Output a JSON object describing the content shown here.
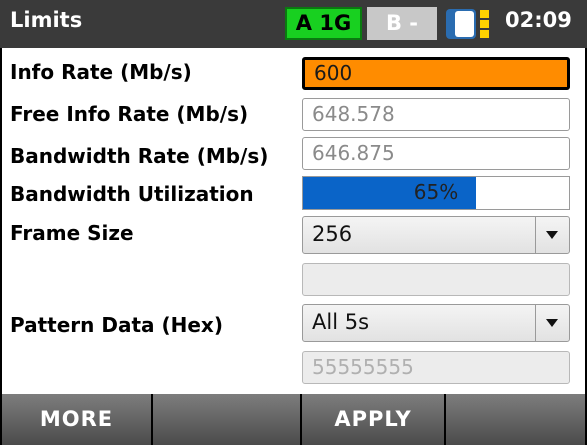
{
  "header": {
    "title": "Limits",
    "port_a": "A 1G",
    "port_b": "B -",
    "time": "02:09",
    "battery_icon": "battery-icon"
  },
  "fields": {
    "info_rate": {
      "label": "Info Rate (Mb/s)",
      "value": "600"
    },
    "free_info_rate": {
      "label": "Free Info Rate (Mb/s)",
      "value": "648.578"
    },
    "bandwidth_rate": {
      "label": "Bandwidth Rate (Mb/s)",
      "value": "646.875"
    },
    "bandwidth_utilization": {
      "label": "Bandwidth Utilization",
      "value": "65%",
      "fraction": 0.65
    },
    "frame_size": {
      "label": "Frame Size",
      "value": "256"
    },
    "frame_size_extra": {
      "value": ""
    },
    "pattern_data": {
      "label": "Pattern Data (Hex)",
      "value": "All 5s"
    },
    "pattern_hex": {
      "value": "55555555"
    }
  },
  "footer": {
    "buttons": [
      "MORE",
      "",
      "APPLY",
      ""
    ]
  },
  "colors": {
    "header_bg": "#3a3a3a",
    "active_field": "#ff8c00",
    "port_a_bg": "#18d020",
    "progress_fill": "#0a64c8",
    "battery_accent": "#ffd200"
  }
}
